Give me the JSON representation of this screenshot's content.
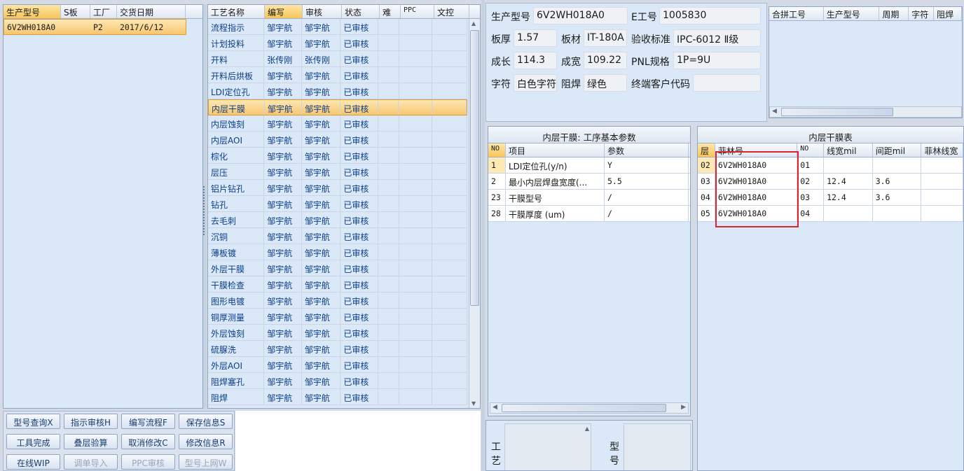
{
  "left_grid": {
    "headers": [
      "生产型号",
      "S板",
      "工厂",
      "交货日期"
    ],
    "rows": [
      [
        "6V2WH018A0",
        "",
        "P2",
        "2017/6/12"
      ]
    ]
  },
  "process_grid": {
    "headers": [
      "工艺名称",
      "编写",
      "审核",
      "状态",
      "难",
      "PPC",
      "文控"
    ],
    "rows": [
      [
        "流程指示",
        "邹宇航",
        "邹宇航",
        "已审核"
      ],
      [
        "计划投料",
        "邹宇航",
        "邹宇航",
        "已审核"
      ],
      [
        "开料",
        "张传刚",
        "张传刚",
        "已审核"
      ],
      [
        "开料后烘板",
        "邹宇航",
        "邹宇航",
        "已审核"
      ],
      [
        "LDI定位孔",
        "邹宇航",
        "邹宇航",
        "已审核"
      ],
      [
        "内层干膜",
        "邹宇航",
        "邹宇航",
        "已审核"
      ],
      [
        "内层蚀刻",
        "邹宇航",
        "邹宇航",
        "已审核"
      ],
      [
        "内层AOI",
        "邹宇航",
        "邹宇航",
        "已审核"
      ],
      [
        "棕化",
        "邹宇航",
        "邹宇航",
        "已审核"
      ],
      [
        "层压",
        "邹宇航",
        "邹宇航",
        "已审核"
      ],
      [
        "铝片钻孔",
        "邹宇航",
        "邹宇航",
        "已审核"
      ],
      [
        "钻孔",
        "邹宇航",
        "邹宇航",
        "已审核"
      ],
      [
        "去毛刺",
        "邹宇航",
        "邹宇航",
        "已审核"
      ],
      [
        "沉铜",
        "邹宇航",
        "邹宇航",
        "已审核"
      ],
      [
        "薄板镀",
        "邹宇航",
        "邹宇航",
        "已审核"
      ],
      [
        "外层干膜",
        "邹宇航",
        "邹宇航",
        "已审核"
      ],
      [
        "干膜检查",
        "邹宇航",
        "邹宇航",
        "已审核"
      ],
      [
        "图形电镀",
        "邹宇航",
        "邹宇航",
        "已审核"
      ],
      [
        "铜厚测量",
        "邹宇航",
        "邹宇航",
        "已审核"
      ],
      [
        "外层蚀刻",
        "邹宇航",
        "邹宇航",
        "已审核"
      ],
      [
        "硫脲洗",
        "邹宇航",
        "邹宇航",
        "已审核"
      ],
      [
        "外层AOI",
        "邹宇航",
        "邹宇航",
        "已审核"
      ],
      [
        "阻焊塞孔",
        "邹宇航",
        "邹宇航",
        "已审核"
      ],
      [
        "阻焊",
        "邹宇航",
        "邹宇航",
        "已审核"
      ]
    ]
  },
  "buttons": {
    "row1": [
      "型号查询X",
      "指示审核H",
      "编写流程F",
      "保存信息S"
    ],
    "row2": [
      "工具完成",
      "叠层验算",
      "取消修改C",
      "修改信息R"
    ],
    "row3": [
      "在线WIP",
      "调单导入",
      "PPC审核",
      "型号上网W"
    ]
  },
  "info": {
    "model_label": "生产型号",
    "model_value": "6V2WH018A0",
    "e_label": "E工号",
    "e_value": "1005830",
    "thickness_label": "板厚",
    "thickness_value": "1.57",
    "material_label": "板材",
    "material_value": "IT-180A",
    "standard_label": "验收标准",
    "standard_value": "IPC-6012 Ⅱ级",
    "length_label": "成长",
    "length_value": "114.3",
    "width_label": "成宽",
    "width_value": "109.22",
    "pnl_label": "PNL规格",
    "pnl_value": "1P=9U",
    "char_label": "字符",
    "char_value": "白色字符",
    "mask_label": "阻焊",
    "mask_value": "绿色",
    "customer_label": "终端客户代码",
    "customer_value": ""
  },
  "merge_grid": {
    "headers": [
      "合拼工号",
      "生产型号",
      "周期",
      "字符",
      "阻焊"
    ]
  },
  "params_panel": {
    "title": "内层干膜: 工序基本参数",
    "headers": [
      "NO",
      "项目",
      "参数"
    ],
    "rows": [
      [
        "1",
        "LDI定位孔(y/n)",
        "Y"
      ],
      [
        "2",
        "最小内层焊盘宽度(...",
        "5.5"
      ],
      [
        "23",
        "干膜型号",
        "/"
      ],
      [
        "28",
        "干膜厚度 (um)",
        "/"
      ]
    ]
  },
  "film_panel": {
    "title": "内层干膜表",
    "headers": [
      "层",
      "菲林号",
      "NO",
      "线宽mil",
      "间距mil",
      "菲林线宽"
    ],
    "rows": [
      [
        "02",
        "6V2WH018A0",
        "01",
        "",
        "",
        ""
      ],
      [
        "03",
        "6V2WH018A0",
        "02",
        "12.4",
        "3.6",
        ""
      ],
      [
        "04",
        "6V2WH018A0",
        "03",
        "12.4",
        "3.6",
        ""
      ],
      [
        "05",
        "6V2WH018A0",
        "04",
        "",
        "",
        ""
      ]
    ]
  },
  "bottom": {
    "process_label": "工艺",
    "model_label": "型号"
  },
  "colors": {
    "selection": "#f7c770",
    "highlight_box": "#d9262c",
    "panel_bg": "#dbe8f7"
  }
}
